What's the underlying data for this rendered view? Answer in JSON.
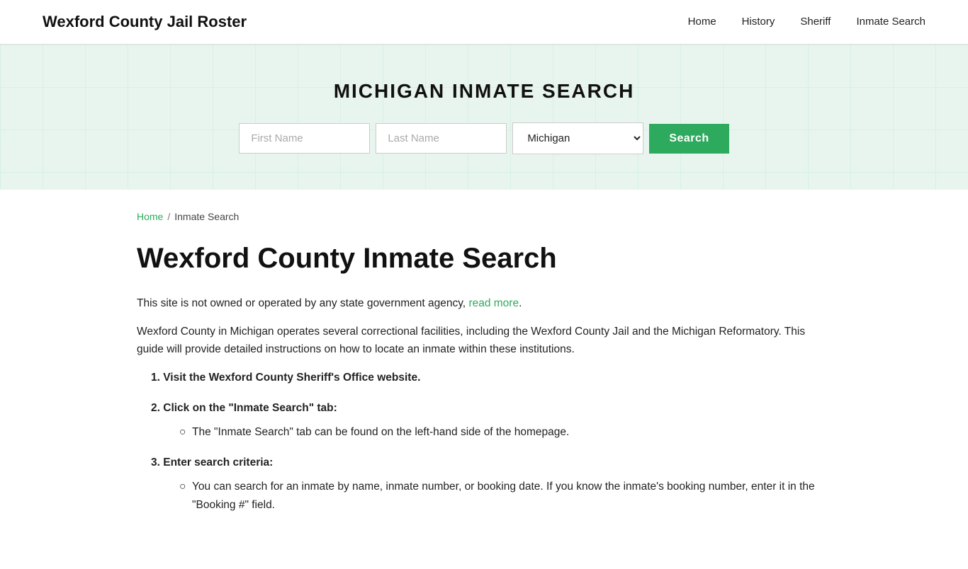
{
  "header": {
    "site_title": "Wexford County Jail Roster",
    "nav": [
      {
        "label": "Home",
        "href": "#"
      },
      {
        "label": "History",
        "href": "#"
      },
      {
        "label": "Sheriff",
        "href": "#"
      },
      {
        "label": "Inmate Search",
        "href": "#"
      }
    ]
  },
  "hero": {
    "title": "MICHIGAN INMATE SEARCH",
    "search": {
      "first_name_placeholder": "First Name",
      "last_name_placeholder": "Last Name",
      "state_default": "Michigan",
      "state_options": [
        "Michigan"
      ],
      "button_label": "Search"
    }
  },
  "breadcrumb": {
    "home_label": "Home",
    "separator": "/",
    "current": "Inmate Search"
  },
  "main": {
    "page_heading": "Wexford County Inmate Search",
    "intro_text": "This site is not owned or operated by any state government agency,",
    "read_more_label": "read more",
    "intro_period": ".",
    "description": "Wexford County in Michigan operates several correctional facilities, including the Wexford County Jail and the Michigan Reformatory. This guide will provide detailed instructions on how to locate an inmate within these institutions.",
    "steps": [
      {
        "label": "Visit the Wexford County Sheriff's Office website.",
        "sub_items": []
      },
      {
        "label": "Click on the \"Inmate Search\" tab:",
        "sub_items": [
          "The \"Inmate Search\" tab can be found on the left-hand side of the homepage."
        ]
      },
      {
        "label": "Enter search criteria:",
        "sub_items": [
          "You can search for an inmate by name, inmate number, or booking date. If you know the inmate's booking number, enter it in the \"Booking #\" field."
        ]
      }
    ]
  }
}
